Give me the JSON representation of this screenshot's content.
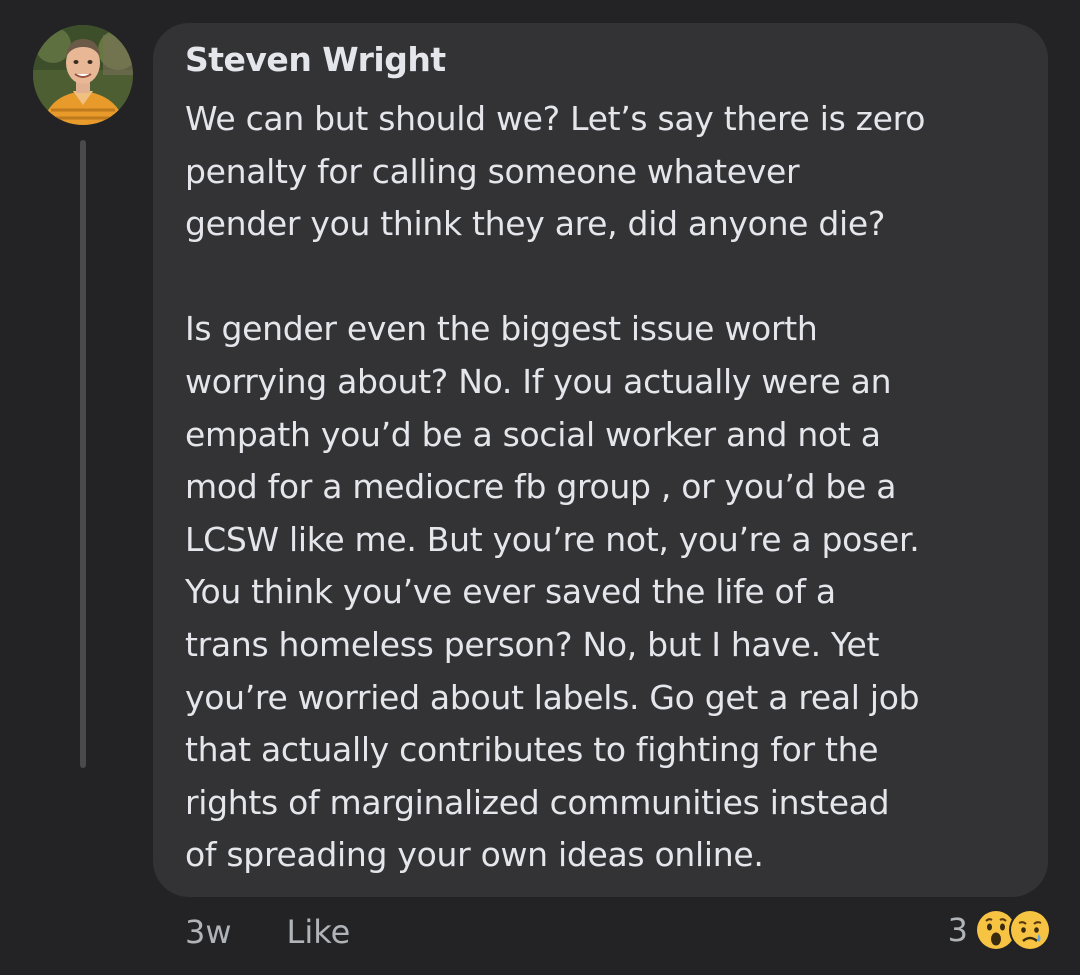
{
  "comment": {
    "author": "Steven Wright",
    "paragraphs": [
      "We can but should we? Let’s say there is zero\npenalty for calling someone whatever\ngender you think they are, did anyone die?",
      "Is gender even the biggest issue worth\nworrying about? No. If you actually were an\nempath you’d be a social worker and not a\nmod for a mediocre fb group , or you’d be a\nLCSW like me. But you’re not, you’re a poser.\nYou think you’ve ever saved the life of a\ntrans homeless person? No, but I have.  Yet\nyou’re worried about labels. Go get a real job\nthat actually contributes to fighting for the\nrights of marginalized communities instead\nof spreading your own ideas online."
    ]
  },
  "actions": {
    "time": "3w",
    "like_label": "Like"
  },
  "reactions": {
    "count": "3",
    "icons": [
      "wow-reaction-icon",
      "sad-reaction-icon"
    ]
  },
  "colors": {
    "background": "#232325",
    "bubble": "#333335",
    "text": "#e4e6eb",
    "muted": "#b0b3b8",
    "reaction_yellow": "#f7c342"
  }
}
